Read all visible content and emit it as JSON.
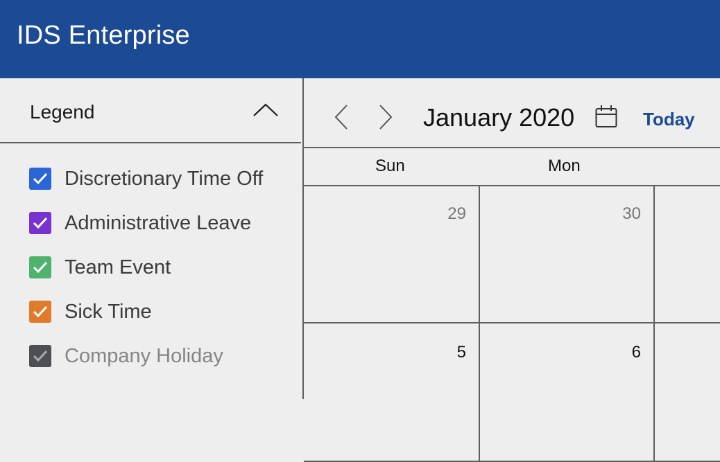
{
  "header": {
    "title": "IDS Enterprise"
  },
  "legend": {
    "title": "Legend",
    "items": [
      {
        "label": "Discretionary Time Off",
        "color": "#2a66d6",
        "checked": true
      },
      {
        "label": "Administrative Leave",
        "color": "#7732d0",
        "checked": true
      },
      {
        "label": "Team Event",
        "color": "#4fb36e",
        "checked": true
      },
      {
        "label": "Sick Time",
        "color": "#e07b2b",
        "checked": true
      },
      {
        "label": "Company Holiday",
        "color": "#4e4e55",
        "checked": true
      }
    ]
  },
  "calendar": {
    "month_title": "January 2020",
    "today_label": "Today",
    "weekdays": [
      "Sun",
      "Mon"
    ],
    "weeks": [
      [
        "29",
        "30"
      ],
      [
        "5",
        "6"
      ]
    ]
  },
  "colors": {
    "header_bg": "#1c4a94",
    "accent": "#1c4a94",
    "background": "#eeeeee"
  }
}
